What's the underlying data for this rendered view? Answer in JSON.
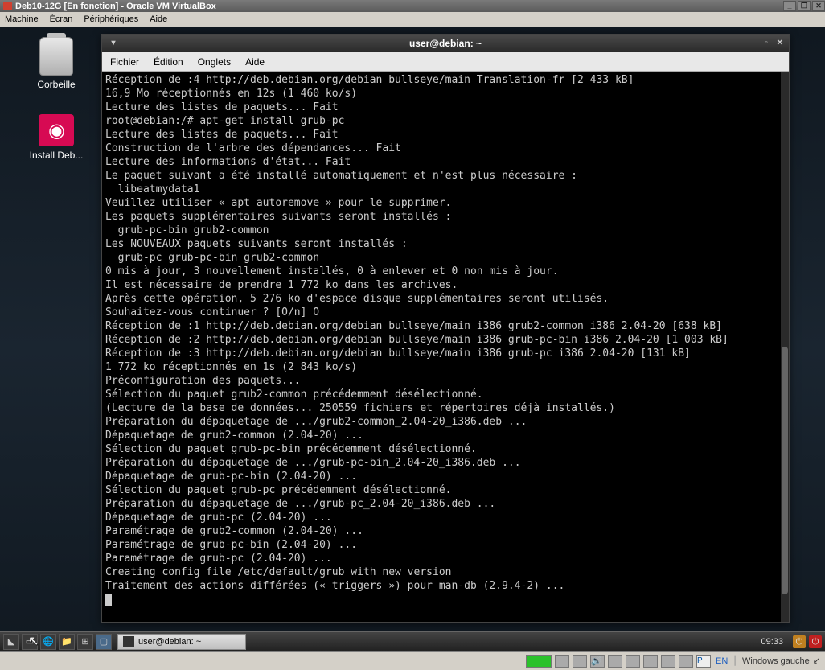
{
  "virtualbox": {
    "title": "Deb10-12G [En fonction] - Oracle VM VirtualBox",
    "menu": {
      "machine": "Machine",
      "ecran": "Écran",
      "peripheriques": "Périphériques",
      "aide": "Aide"
    },
    "status": {
      "host_key": "Windows gauche",
      "lang": "EN",
      "park": "P"
    },
    "win_min": "_",
    "win_max": "❐",
    "win_close": "✕"
  },
  "desktop": {
    "trash_label": "Corbeille",
    "install_label": "Install Deb..."
  },
  "terminal": {
    "title": "user@debian: ~",
    "menu": {
      "fichier": "Fichier",
      "edition": "Édition",
      "onglets": "Onglets",
      "aide": "Aide"
    },
    "controls": {
      "pin": "▾",
      "min": "–",
      "max": "▫",
      "close": "✕"
    },
    "lines": [
      "Réception de :4 http://deb.debian.org/debian bullseye/main Translation-fr [2 433 kB]",
      "16,9 Mo réceptionnés en 12s (1 460 ko/s)",
      "Lecture des listes de paquets... Fait",
      "root@debian:/# apt-get install grub-pc",
      "Lecture des listes de paquets... Fait",
      "Construction de l'arbre des dépendances... Fait",
      "Lecture des informations d'état... Fait",
      "Le paquet suivant a été installé automatiquement et n'est plus nécessaire :",
      "  libeatmydata1",
      "Veuillez utiliser « apt autoremove » pour le supprimer.",
      "Les paquets supplémentaires suivants seront installés :",
      "  grub-pc-bin grub2-common",
      "Les NOUVEAUX paquets suivants seront installés :",
      "  grub-pc grub-pc-bin grub2-common",
      "0 mis à jour, 3 nouvellement installés, 0 à enlever et 0 non mis à jour.",
      "Il est nécessaire de prendre 1 772 ko dans les archives.",
      "Après cette opération, 5 276 ko d'espace disque supplémentaires seront utilisés.",
      "Souhaitez-vous continuer ? [O/n] O",
      "Réception de :1 http://deb.debian.org/debian bullseye/main i386 grub2-common i386 2.04-20 [638 kB]",
      "Réception de :2 http://deb.debian.org/debian bullseye/main i386 grub-pc-bin i386 2.04-20 [1 003 kB]",
      "Réception de :3 http://deb.debian.org/debian bullseye/main i386 grub-pc i386 2.04-20 [131 kB]",
      "1 772 ko réceptionnés en 1s (2 843 ko/s)",
      "Préconfiguration des paquets...",
      "Sélection du paquet grub2-common précédemment désélectionné.",
      "(Lecture de la base de données... 250559 fichiers et répertoires déjà installés.)",
      "Préparation du dépaquetage de .../grub2-common_2.04-20_i386.deb ...",
      "Dépaquetage de grub2-common (2.04-20) ...",
      "Sélection du paquet grub-pc-bin précédemment désélectionné.",
      "Préparation du dépaquetage de .../grub-pc-bin_2.04-20_i386.deb ...",
      "Dépaquetage de grub-pc-bin (2.04-20) ...",
      "Sélection du paquet grub-pc précédemment désélectionné.",
      "Préparation du dépaquetage de .../grub-pc_2.04-20_i386.deb ...",
      "Dépaquetage de grub-pc (2.04-20) ...",
      "Paramétrage de grub2-common (2.04-20) ...",
      "Paramétrage de grub-pc-bin (2.04-20) ...",
      "Paramétrage de grub-pc (2.04-20) ...",
      "",
      "Creating config file /etc/default/grub with new version",
      "Traitement des actions différées (« triggers ») pour man-db (2.9.4-2) ..."
    ]
  },
  "taskbar": {
    "active_task": "user@debian: ~",
    "clock": "09:33"
  }
}
